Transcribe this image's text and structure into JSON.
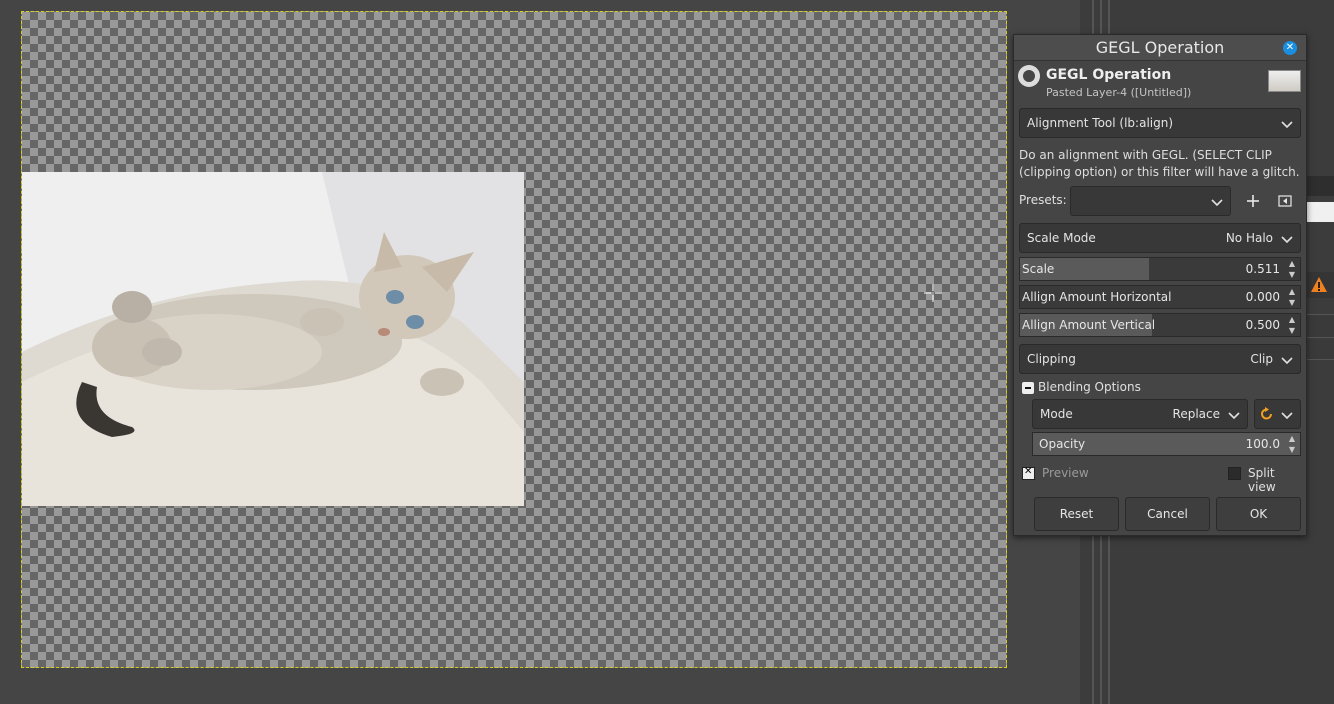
{
  "dialog": {
    "title": "GEGL Operation",
    "header_title": "GEGL Operation",
    "header_subtitle": "Pasted Layer-4 ([Untitled])"
  },
  "operation": {
    "selected": "Alignment Tool (lb:align)",
    "description": "Do an alignment with GEGL. (SELECT CLIP (clipping option) or this filter will have a glitch."
  },
  "presets": {
    "label": "Presets:",
    "value": ""
  },
  "scale_mode": {
    "label": "Scale Mode",
    "value": "No Halo"
  },
  "params": [
    {
      "label": "Scale",
      "value": "0.511",
      "fill": 0.46
    },
    {
      "label": "Allign Amount Horizontal",
      "value": "0.000",
      "fill": 0.0
    },
    {
      "label": "Allign Amount Vertical",
      "value": "0.500",
      "fill": 0.47
    }
  ],
  "clipping": {
    "label": "Clipping",
    "value": "Clip"
  },
  "blending": {
    "label": "Blending Options",
    "mode_label": "Mode",
    "mode_value": "Replace",
    "opacity_label": "Opacity",
    "opacity_value": "100.0",
    "opacity_fill": 1.0
  },
  "preview": {
    "label": "Preview",
    "checked": true
  },
  "split_view": {
    "label": "Split view",
    "checked": false
  },
  "buttons": {
    "reset": "Reset",
    "cancel": "Cancel",
    "ok": "OK"
  },
  "colors": {
    "accent_close": "#1a8fe0",
    "layer_boundary": "#d8d020",
    "reset_icon": "#f0a020",
    "warning_icon": "#f08020"
  },
  "icons": [
    "close-icon",
    "gimp-logo-icon",
    "chevron-down-icon",
    "plus-icon",
    "preset-menu-icon",
    "reset-arrow-icon",
    "warning-icon",
    "crosshair-icon"
  ]
}
